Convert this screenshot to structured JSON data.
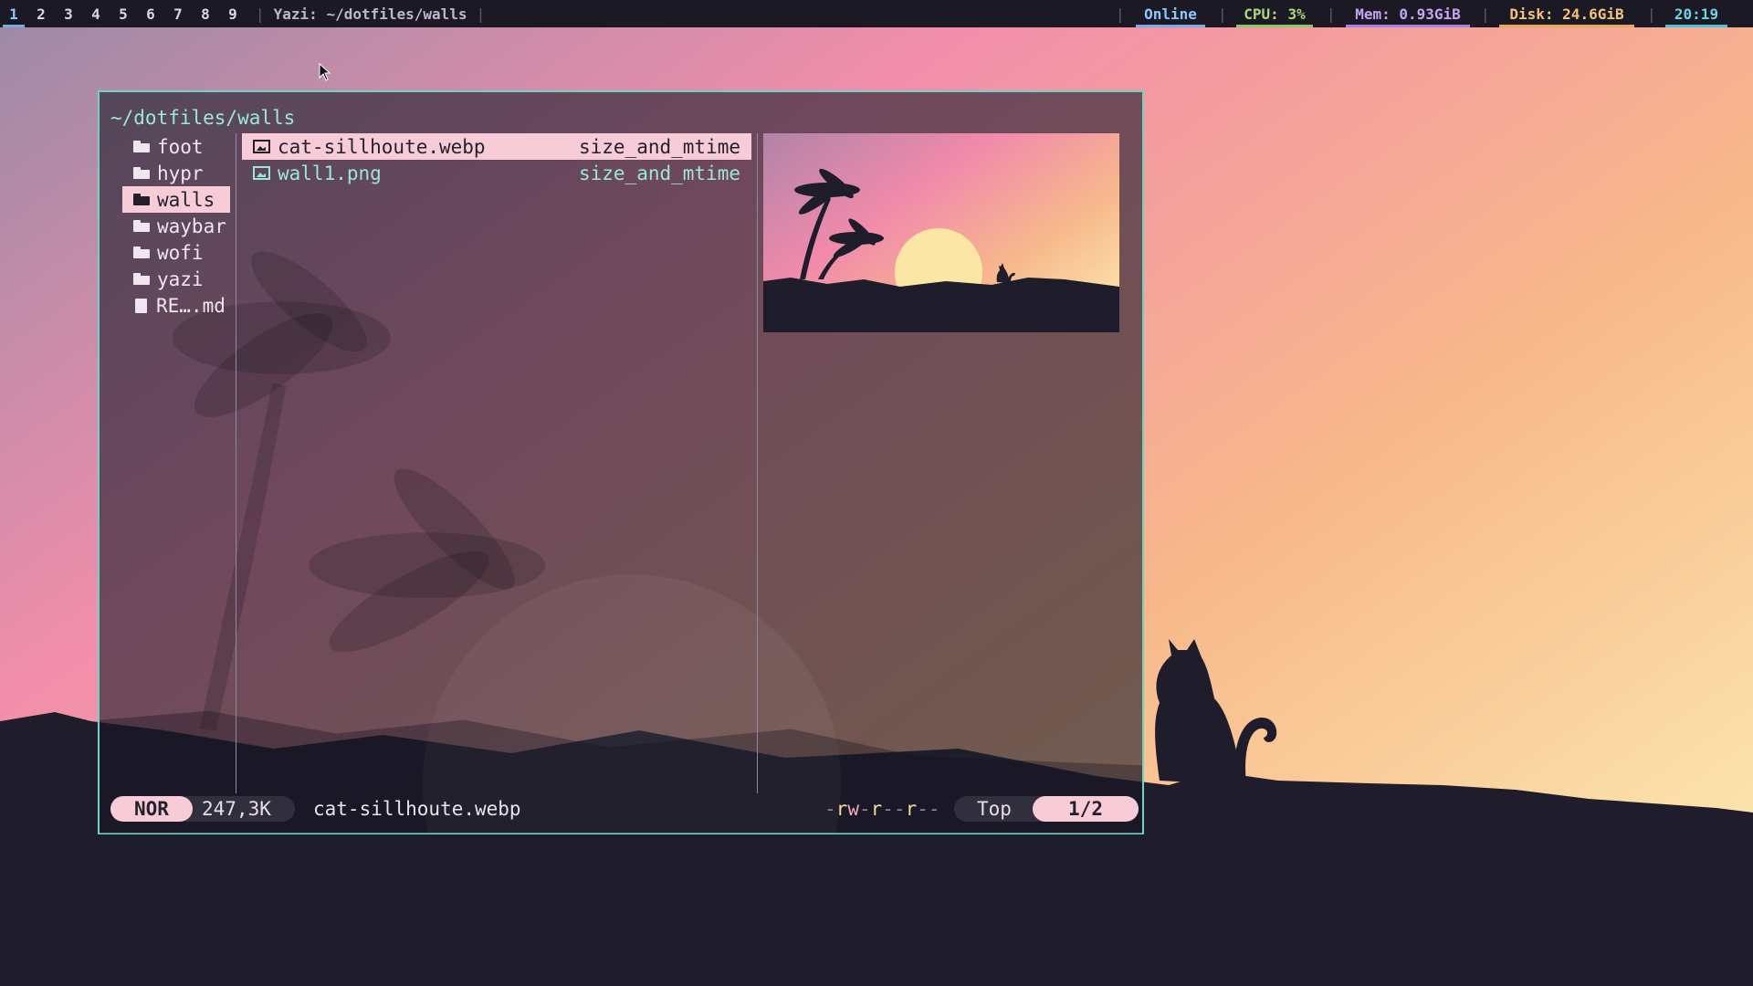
{
  "topbar": {
    "workspaces": [
      "1",
      "2",
      "3",
      "4",
      "5",
      "6",
      "7",
      "8",
      "9"
    ],
    "active_workspace": "1",
    "window_title": "Yazi: ~/dotfiles/walls",
    "modules": {
      "network": {
        "label": "Online",
        "color": "#8cc6ff",
        "bar": "#7aa8e8"
      },
      "cpu": {
        "label": "CPU: 3%",
        "color": "#a9d77a",
        "bar": "#8fc565"
      },
      "mem": {
        "label": "Mem: 0.93GiB",
        "color": "#c6a4f2",
        "bar": "#a882e3"
      },
      "disk": {
        "label": "Disk: 24.6GiB",
        "color": "#f4c27a",
        "bar": "#e6a95b"
      },
      "clock": {
        "label": "20:19",
        "color": "#6fd3e8",
        "bar": "#4fc0d8"
      }
    }
  },
  "yazi": {
    "path": "~/dotfiles/walls",
    "parent_items": [
      {
        "name": "foot",
        "type": "folder"
      },
      {
        "name": "hypr",
        "type": "folder"
      },
      {
        "name": "walls",
        "type": "folder",
        "selected": true
      },
      {
        "name": "waybar",
        "type": "folder"
      },
      {
        "name": "wofi",
        "type": "folder"
      },
      {
        "name": "yazi",
        "type": "folder"
      },
      {
        "name": "RE….md",
        "type": "file"
      }
    ],
    "files": [
      {
        "name": "cat-sillhoute.webp",
        "meta": "size_and_mtime",
        "selected": true,
        "icon": "image-icon"
      },
      {
        "name": "wall1.png",
        "meta": "size_and_mtime",
        "selected": false,
        "icon": "image-icon"
      }
    ],
    "status": {
      "mode": "NOR",
      "size": "247,3K",
      "filename": "cat-sillhoute.webp",
      "permissions": "-rw-r--r--",
      "position": "Top",
      "count": "1/2"
    }
  },
  "colors": {
    "accent": "#6fd3c4",
    "selection": "#f8ccd6",
    "sky_top": "#f38bab",
    "sky_bottom": "#fad9a7",
    "ground": "#1f1d2b"
  }
}
